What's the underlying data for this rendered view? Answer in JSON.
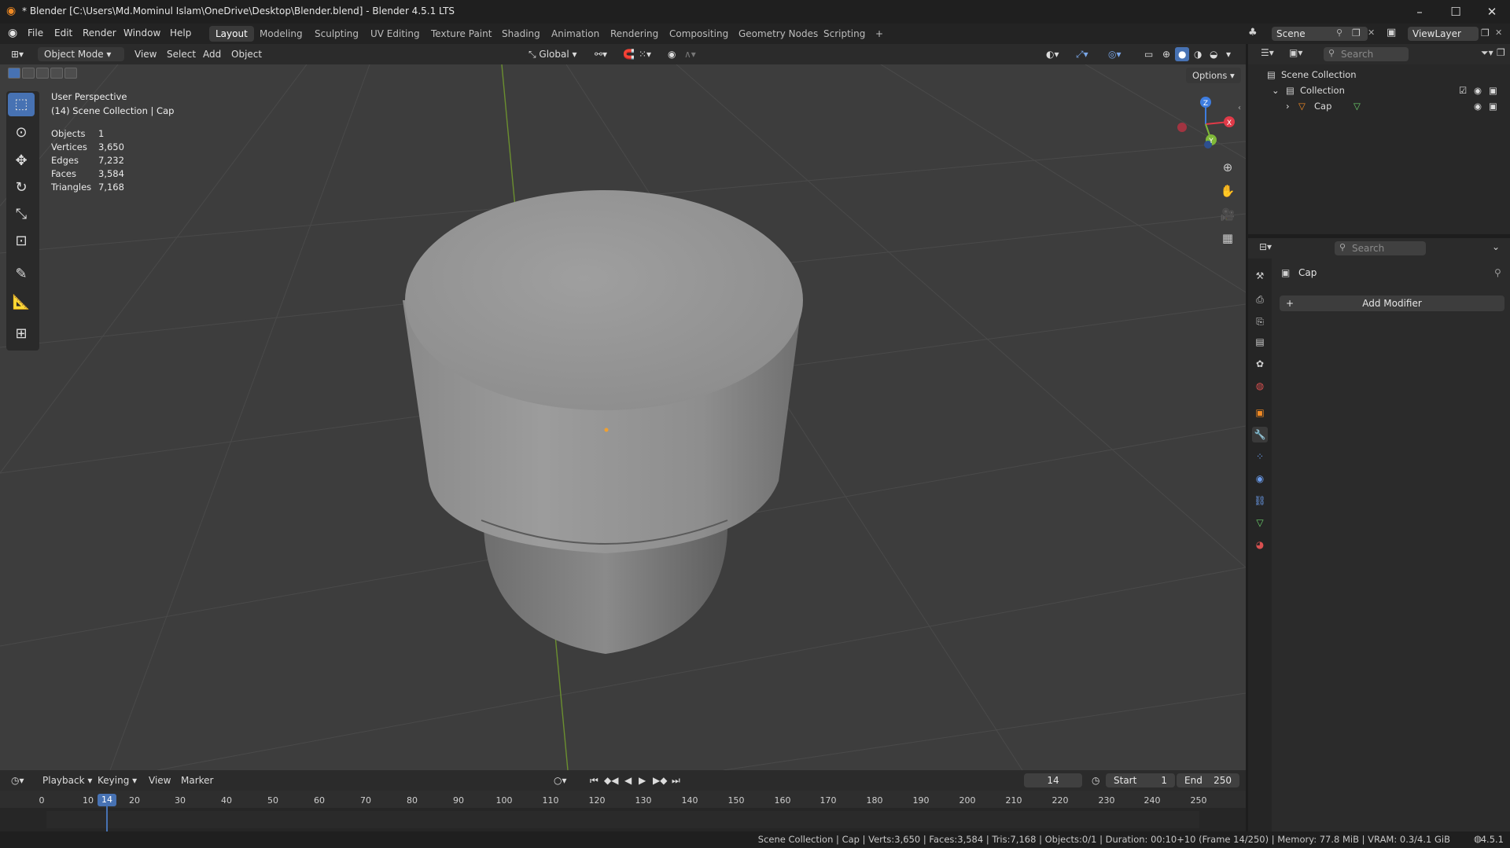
{
  "window": {
    "title": "* Blender [C:\\Users\\Md.Mominul Islam\\OneDrive\\Desktop\\Blender.blend] - Blender 4.5.1 LTS",
    "minimize": "–",
    "maximize": "☐",
    "close": "✕"
  },
  "menu": {
    "items": [
      "File",
      "Edit",
      "Render",
      "Window",
      "Help"
    ]
  },
  "workspaces": {
    "tabs": [
      "Layout",
      "Modeling",
      "Sculpting",
      "UV Editing",
      "Texture Paint",
      "Shading",
      "Animation",
      "Rendering",
      "Compositing",
      "Geometry Nodes",
      "Scripting"
    ],
    "add": "+"
  },
  "scene": {
    "label": "Scene",
    "view_layer": "ViewLayer"
  },
  "viewport_header": {
    "mode": "Object Mode",
    "menus": [
      "View",
      "Select",
      "Add",
      "Object"
    ],
    "transform_orientation": "Global",
    "options": "Options"
  },
  "overlay": {
    "perspective": "User Perspective",
    "context": "(14) Scene Collection | Cap",
    "stats": [
      {
        "label": "Objects",
        "value": "1"
      },
      {
        "label": "Vertices",
        "value": "3,650"
      },
      {
        "label": "Edges",
        "value": "7,232"
      },
      {
        "label": "Faces",
        "value": "3,584"
      },
      {
        "label": "Triangles",
        "value": "7,168"
      }
    ]
  },
  "gizmo": {
    "x": "X",
    "y": "Y",
    "z": "Z"
  },
  "outliner": {
    "search_placeholder": "Search",
    "rows": [
      "Scene Collection",
      "Collection",
      "Cap"
    ]
  },
  "properties": {
    "search_placeholder": "Search",
    "object_name": "Cap",
    "add_modifier": "Add Modifier"
  },
  "timeline": {
    "menus": [
      "Playback",
      "Keying",
      "View",
      "Marker"
    ],
    "current_frame": "14",
    "start_label": "Start",
    "start_value": "1",
    "end_label": "End",
    "end_value": "250",
    "ticks": [
      "0",
      "10",
      "20",
      "30",
      "40",
      "50",
      "60",
      "70",
      "80",
      "90",
      "100",
      "110",
      "120",
      "130",
      "140",
      "150",
      "160",
      "170",
      "180",
      "190",
      "200",
      "210",
      "220",
      "230",
      "240",
      "250"
    ]
  },
  "statusbar": {
    "text": "Scene Collection | Cap | Verts:3,650 | Faces:3,584 | Tris:7,168 | Objects:0/1 | Duration: 00:10+10 (Frame 14/250) | Memory: 77.8 MiB | VRAM: 0.3/4.1 GiB",
    "version": "4.5.1"
  },
  "colors": {
    "accent": "#4772b3",
    "viewport_bg": "#3d3d3d",
    "x_axis": "#e03a48",
    "y_axis": "#7fb838",
    "z_axis": "#3e7de0"
  }
}
